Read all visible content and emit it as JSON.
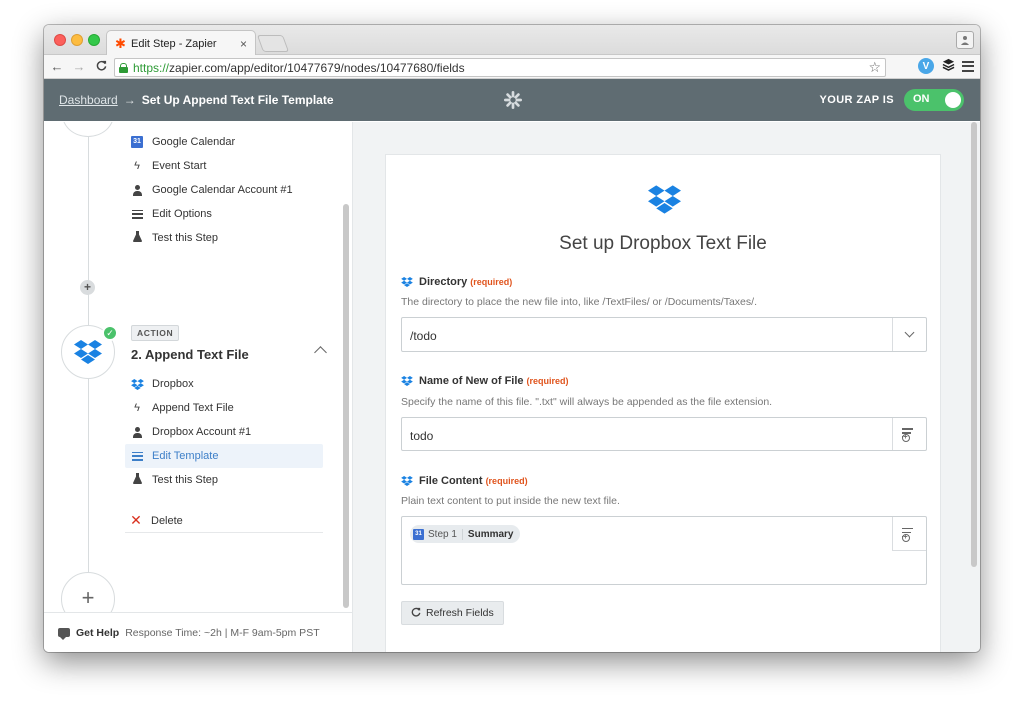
{
  "browser": {
    "tab_title": "Edit Step - Zapier",
    "tab_close": "×",
    "url_secure": "https://",
    "url_rest": "zapier.com/app/editor/10477679/nodes/10477680/fields",
    "ext_label": "V"
  },
  "header": {
    "breadcrumb_link": "Dashboard",
    "breadcrumb_arrow": "→",
    "breadcrumb_current": "Set Up Append Text File Template",
    "zap_label": "YOUR ZAP IS",
    "toggle_label": "ON"
  },
  "sidebar": {
    "trigger_items": [
      {
        "label": "Google Calendar",
        "icon": "google-calendar-icon"
      },
      {
        "label": "Event Start",
        "icon": "bolt-icon"
      },
      {
        "label": "Google Calendar Account #1",
        "icon": "user-icon"
      },
      {
        "label": "Edit Options",
        "icon": "lines-icon"
      },
      {
        "label": "Test this Step",
        "icon": "flask-icon"
      }
    ],
    "action_badge": "ACTION",
    "step_title": "2. Append Text File",
    "action_items": [
      {
        "label": "Dropbox",
        "icon": "dropbox-icon"
      },
      {
        "label": "Append Text File",
        "icon": "bolt-icon"
      },
      {
        "label": "Dropbox Account #1",
        "icon": "user-icon"
      },
      {
        "label": "Edit Template",
        "icon": "lines-icon",
        "active": true
      },
      {
        "label": "Test this Step",
        "icon": "flask-icon"
      }
    ],
    "delete_label": "Delete",
    "get_help": "Get Help",
    "response_time": "Response Time: ~2h | M-F 9am-5pm PST",
    "calendar_glyph": "31"
  },
  "form": {
    "title": "Set up Dropbox Text File",
    "required_tag": "(required)",
    "directory": {
      "label": "Directory",
      "help": "The directory to place the new file into, like /TextFiles/ or /Documents/Taxes/.",
      "value": "/todo"
    },
    "file_name": {
      "label": "Name of New of File",
      "help": "Specify the name of this file. \".txt\" will always be appended as the file extension.",
      "value": "todo"
    },
    "file_content": {
      "label": "File Content",
      "help": "Plain text content to put inside the new text file.",
      "pill_step": "Step 1",
      "pill_field": "Summary"
    },
    "refresh_label": "Refresh Fields"
  },
  "colors": {
    "header_bg": "#5f6c72",
    "toggle_on": "#4bc26b",
    "dropbox_blue": "#1a82e2",
    "required": "#e0541d",
    "active_item": "#3d7fc8"
  }
}
